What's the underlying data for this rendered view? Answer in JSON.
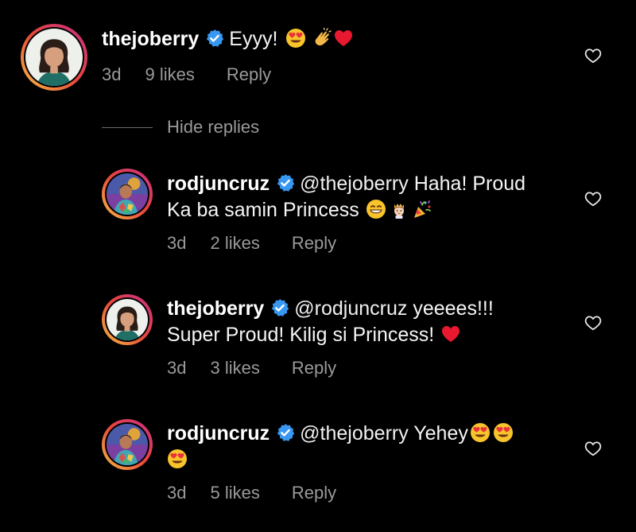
{
  "comments": [
    {
      "username": "thejoberry",
      "mention": "",
      "line1": "Eyyy!",
      "line2": "",
      "time": "3d",
      "likes": "9 likes",
      "reply": "Reply",
      "emojis_line1": [
        "heart-eyes-emoji",
        "clapping-hands-emoji",
        "red-heart-emoji"
      ]
    },
    {
      "username": "rodjuncruz",
      "mention": "@thejoberry",
      "line1": "Haha! Proud",
      "line2": "Ka ba samin Princess",
      "time": "3d",
      "likes": "2 likes",
      "reply": "Reply",
      "emojis_line2": [
        "grinning-emoji",
        "princess-emoji",
        "party-popper-emoji"
      ]
    },
    {
      "username": "thejoberry",
      "mention": "@rodjuncruz",
      "line1": "yeeees!!!",
      "line2": "Super Proud! Kilig si Princess!",
      "time": "3d",
      "likes": "3 likes",
      "reply": "Reply",
      "emojis_line2": [
        "red-heart-emoji"
      ]
    },
    {
      "username": "rodjuncruz",
      "mention": "@thejoberry",
      "line1": "Yehey",
      "line2": "",
      "time": "3d",
      "likes": "5 likes",
      "reply": "Reply",
      "emojis_line1": [
        "heart-eyes-emoji",
        "heart-eyes-emoji"
      ],
      "emojis_line2": [
        "heart-eyes-emoji"
      ]
    }
  ],
  "thread": {
    "hide_replies": "Hide replies"
  },
  "colors": {
    "background": "#000000",
    "meta_text": "#9a9a9a",
    "verified_badge": "#3897f0",
    "avatar_ring": "#e8463a",
    "like_heart": "#e6e6e6"
  }
}
